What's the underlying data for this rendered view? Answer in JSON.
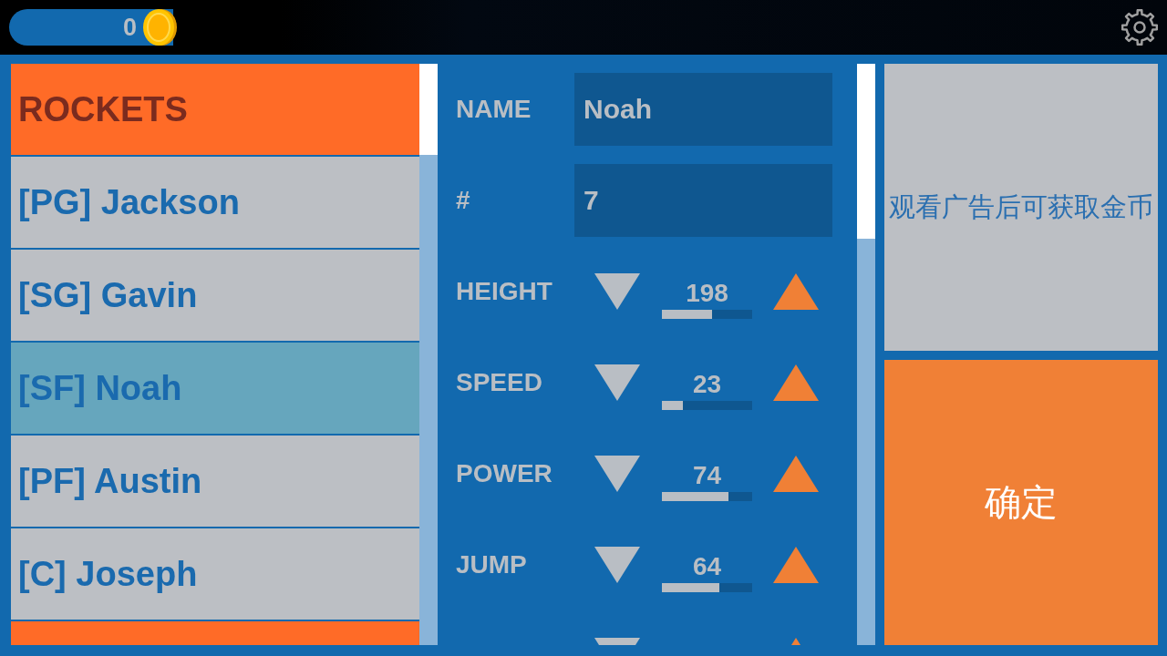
{
  "coins": {
    "count": "0"
  },
  "roster": {
    "items": [
      {
        "kind": "team",
        "label": "ROCKETS",
        "selected": false
      },
      {
        "kind": "player",
        "label": "[PG] Jackson",
        "selected": false
      },
      {
        "kind": "player",
        "label": "[SG] Gavin",
        "selected": false
      },
      {
        "kind": "player",
        "label": "[SF] Noah",
        "selected": true
      },
      {
        "kind": "player",
        "label": "[PF] Austin",
        "selected": false
      },
      {
        "kind": "player",
        "label": "[C] Joseph",
        "selected": false
      },
      {
        "kind": "team",
        "selected": false
      }
    ]
  },
  "editor": {
    "fields": [
      {
        "label": "NAME",
        "value": "Noah"
      },
      {
        "label": "#",
        "value": "7"
      }
    ],
    "stats": [
      {
        "kind": "full",
        "label": "HEIGHT",
        "value": "198",
        "level": 0.56
      },
      {
        "kind": "full",
        "label": "SPEED",
        "value": "23",
        "level": 0.23
      },
      {
        "kind": "full",
        "label": "POWER",
        "value": "74",
        "level": 0.74
      },
      {
        "kind": "full",
        "label": "JUMP",
        "value": "64",
        "level": 0.64
      },
      {
        "kind": "clipped"
      }
    ]
  },
  "buttons": [
    {
      "kind": "ad",
      "label": "观看广告后可获取金币"
    },
    {
      "kind": "confirm",
      "label": "确定"
    }
  ]
}
